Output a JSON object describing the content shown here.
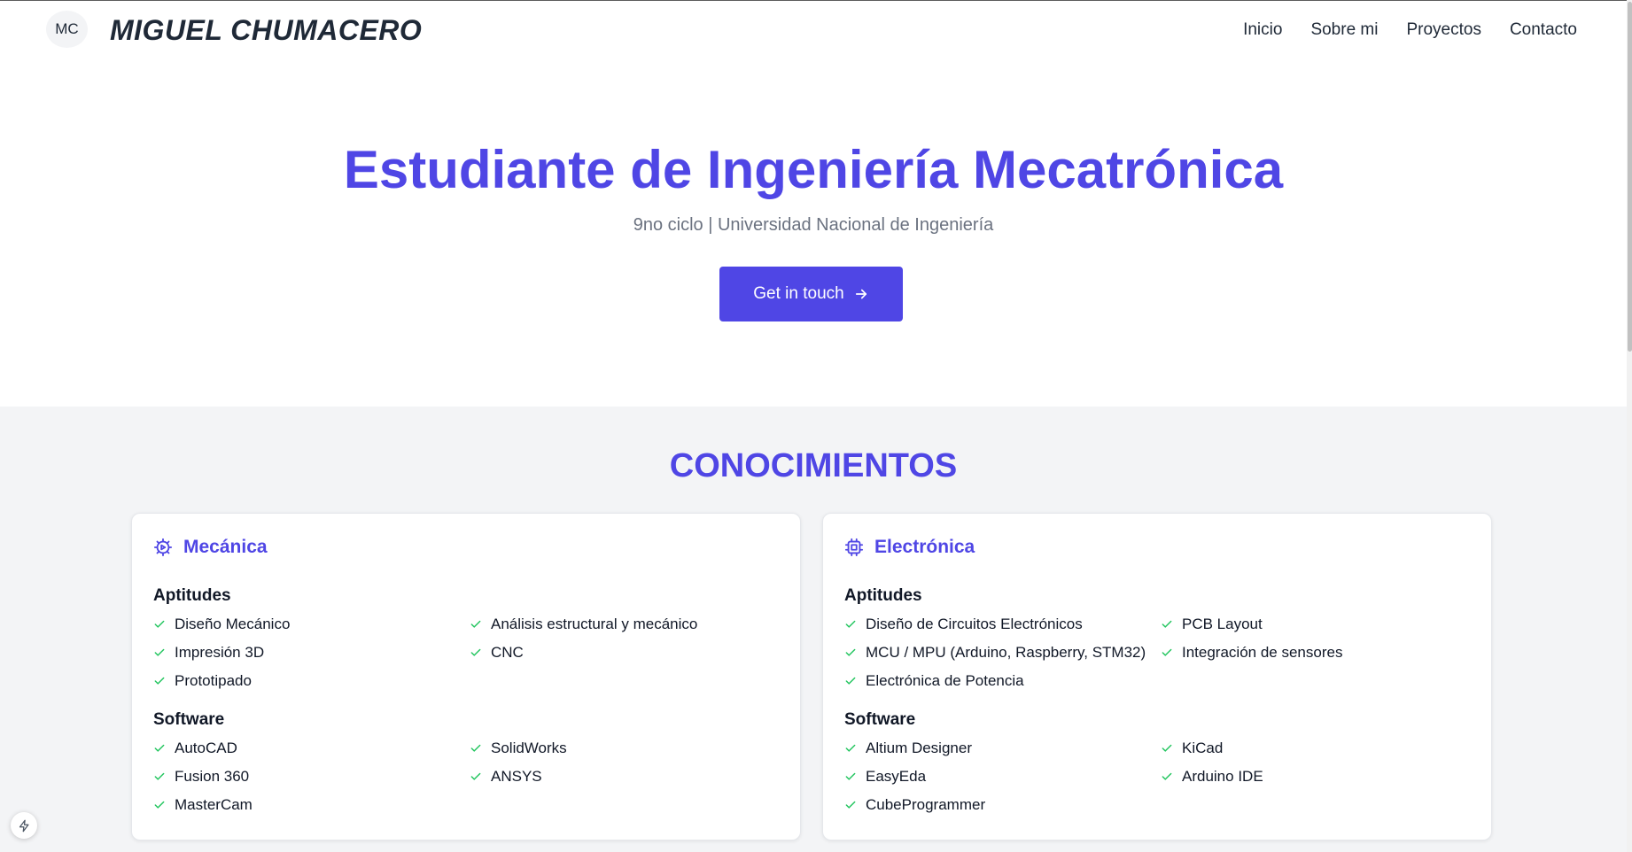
{
  "header": {
    "logo_initials": "MC",
    "site_name": "MIGUEL CHUMACERO",
    "nav": [
      "Inicio",
      "Sobre mi",
      "Proyectos",
      "Contacto"
    ]
  },
  "hero": {
    "title": "Estudiante de Ingeniería Mecatrónica",
    "subtitle": "9no ciclo | Universidad Nacional de Ingeniería",
    "cta_label": "Get in touch",
    "cta_icon": "arrow-right-icon"
  },
  "knowledge": {
    "title": "CONOCIMIENTOS",
    "cards": [
      {
        "title": "Mecánica",
        "icon": "gear-icon",
        "skills_heading": "Aptitudes",
        "skills": [
          "Diseño Mecánico",
          "Análisis estructural y mecánico",
          "Impresión 3D",
          "CNC",
          "Prototipado"
        ],
        "software_heading": "Software",
        "software": [
          "AutoCAD",
          "SolidWorks",
          "Fusion 360",
          "ANSYS",
          "MasterCam"
        ]
      },
      {
        "title": "Electrónica",
        "icon": "chip-icon",
        "skills_heading": "Aptitudes",
        "skills": [
          "Diseño de Circuitos Electrónicos",
          "PCB Layout",
          "MCU / MPU (Arduino, Raspberry, STM32)",
          "Integración de sensores",
          "Electrónica de Potencia"
        ],
        "software_heading": "Software",
        "software": [
          "Altium Designer",
          "KiCad",
          "EasyEda",
          "Arduino IDE",
          "CubeProgrammer"
        ]
      }
    ]
  },
  "colors": {
    "accent": "#4f46e5",
    "check": "#22c55e",
    "section_bg": "#f3f4f6",
    "muted_text": "#6b7280"
  },
  "fab_icon": "lightning-icon"
}
